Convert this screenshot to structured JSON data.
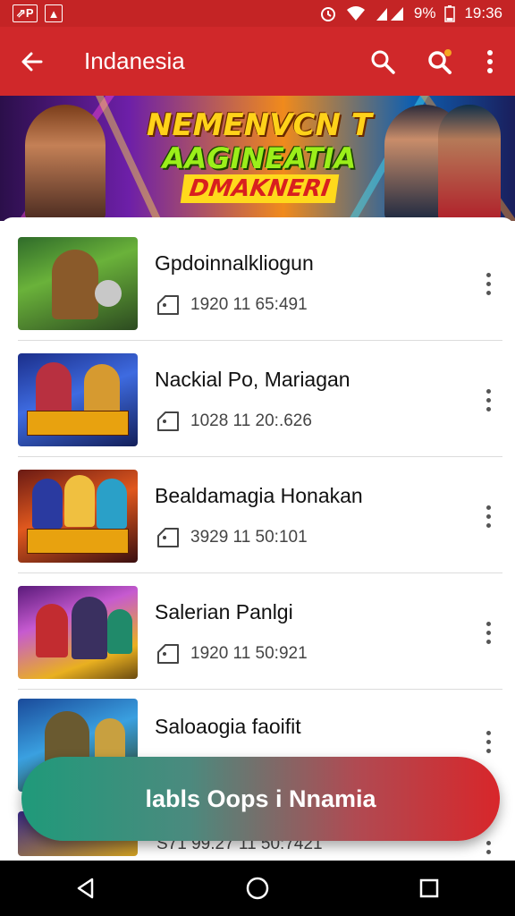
{
  "status_bar": {
    "left_indicators": [
      "⇗P",
      "▲"
    ],
    "battery": "9%",
    "time": "19:36"
  },
  "app_bar": {
    "title": "Indanesia",
    "back_icon": "arrow-left-icon",
    "search_icon": "search-icon",
    "search_alert_icon": "search-notification-icon",
    "more_icon": "more-vert-icon",
    "accent": "#d0282a"
  },
  "banner": {
    "line1": "NEMENVCN T",
    "line2": "AAGINEATIA",
    "line3": "DMAKNERI"
  },
  "items": [
    {
      "title": "Gpdoinnalkliogun",
      "meta": "1920 11 65:491"
    },
    {
      "title": "Nackial Po, Mariagan",
      "meta": "1028 11 20:.626"
    },
    {
      "title": "Bealdamagia Honakan",
      "meta": "3929 11 50:101"
    },
    {
      "title": "Salerian Panlgi",
      "meta": "1920 11 50:921"
    },
    {
      "title": "Saloaogia faoifit",
      "meta": "S71 99.27 11 50:7421"
    }
  ],
  "thumb_labels": [
    "",
    "SPNEMAN\nMUNAN",
    "NEADMAN\nDUNISS",
    "",
    ""
  ],
  "fab": {
    "label": "labls Oops i Nnamia"
  },
  "nav": {
    "back": "back-icon",
    "home": "home-icon",
    "recents": "recents-icon"
  }
}
